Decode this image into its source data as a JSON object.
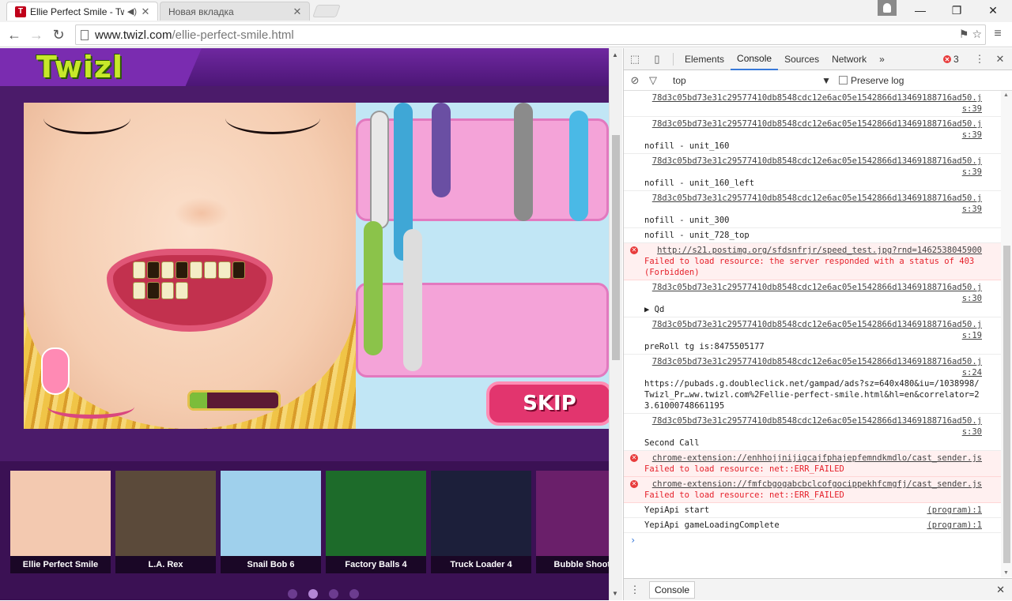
{
  "browser": {
    "tabs": [
      {
        "title": "Ellie Perfect Smile - Twizl",
        "active": true
      },
      {
        "title": "Новая вкладка",
        "active": false
      }
    ],
    "url_host": "www.twizl.com",
    "url_path": "/ellie-perfect-smile.html",
    "window_controls": {
      "minimize": "—",
      "restore": "❐",
      "close": "✕"
    }
  },
  "site": {
    "logo": "Twizl",
    "game": {
      "skip_label": "SKIP",
      "progress": 0.2
    },
    "thumbnails": [
      {
        "title": "Ellie Perfect Smile",
        "color": "#f3c9b0"
      },
      {
        "title": "L.A. Rex",
        "color": "#5b4a3a"
      },
      {
        "title": "Snail Bob 6",
        "color": "#9fd0ec"
      },
      {
        "title": "Factory Balls 4",
        "color": "#1d6b2a"
      },
      {
        "title": "Truck Loader 4",
        "color": "#1c1f3a"
      },
      {
        "title": "Bubble Shooter",
        "color": "#6a1f6a"
      }
    ],
    "pager_dots": 4,
    "pager_active": 1
  },
  "devtools": {
    "tabs": [
      "Elements",
      "Console",
      "Sources",
      "Network"
    ],
    "active_tab": "Console",
    "more_tabs": "»",
    "error_count": "3",
    "context": "top",
    "preserve_log": "Preserve log",
    "drawer_tab": "Console",
    "prompt": "›",
    "messages": [
      {
        "type": "log",
        "src": "78d3c05bd73e31c29577410db8548cdc12e6ac05e1542866d13469188716ad50.js:39",
        "text": ""
      },
      {
        "type": "log",
        "src": "78d3c05bd73e31c29577410db8548cdc12e6ac05e1542866d13469188716ad50.js:39",
        "text": "nofill - unit_160"
      },
      {
        "type": "log",
        "src": "78d3c05bd73e31c29577410db8548cdc12e6ac05e1542866d13469188716ad50.js:39",
        "text": "nofill - unit_160_left"
      },
      {
        "type": "log",
        "src": "78d3c05bd73e31c29577410db8548cdc12e6ac05e1542866d13469188716ad50.js:39",
        "text": "nofill - unit_300"
      },
      {
        "type": "log",
        "src": "",
        "text": "nofill - unit_728_top"
      },
      {
        "type": "err",
        "src": "http://s21.postimg.org/sfdsnfrjr/speed_test.jpg?rnd=1462538045900",
        "text": "Failed to load resource: the server responded with a status of 403 (Forbidden)"
      },
      {
        "type": "log",
        "src": "78d3c05bd73e31c29577410db8548cdc12e6ac05e1542866d13469188716ad50.js:30",
        "text": "▶ Qd"
      },
      {
        "type": "log",
        "src": "78d3c05bd73e31c29577410db8548cdc12e6ac05e1542866d13469188716ad50.js:19",
        "text": "preRoll tg is:8475505177"
      },
      {
        "type": "log",
        "src": "78d3c05bd73e31c29577410db8548cdc12e6ac05e1542866d13469188716ad50.js:24",
        "text": "https://pubads.g.doubleclick.net/gampad/ads?sz=640x480&iu=/1038998/Twizl_Pr…ww.twizl.com%2Fellie-perfect-smile.html&hl=en&correlator=23.61000748661195"
      },
      {
        "type": "log",
        "src": "78d3c05bd73e31c29577410db8548cdc12e6ac05e1542866d13469188716ad50.js:30",
        "text": "Second Call"
      },
      {
        "type": "err",
        "src": "chrome-extension://enhhojjnijigcajfphajepfemndkmdlo/cast_sender.js",
        "text": "Failed to load resource: net::ERR_FAILED"
      },
      {
        "type": "err",
        "src": "chrome-extension://fmfcbgogabcbclcofgocippekhfcmgfj/cast_sender.js",
        "text": "Failed to load resource: net::ERR_FAILED"
      },
      {
        "type": "inline",
        "src": "(program):1",
        "text": "YepiApi start"
      },
      {
        "type": "inline",
        "src": "(program):1",
        "text": "YepiApi gameLoadingComplete"
      }
    ]
  }
}
